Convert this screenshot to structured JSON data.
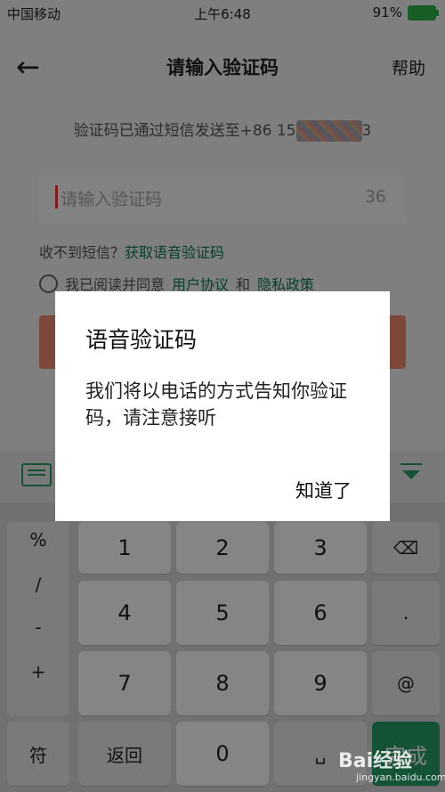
{
  "status_bar": {
    "carrier": "中国移动",
    "time": "上午6:48",
    "battery": "91%"
  },
  "header": {
    "back_icon": "←",
    "title": "请输入验证码",
    "help": "帮助"
  },
  "form": {
    "sent_prefix": "验证码已通过短信发送至+86 15",
    "sent_suffix": "3",
    "code_placeholder": "请输入验证码",
    "countdown": "36",
    "no_sms": "收不到短信？",
    "voice_link": "获取语音验证码",
    "agree_prefix": "我已阅读并同意",
    "user_agreement": "用户协议",
    "and": "和",
    "privacy_policy": "隐私政策"
  },
  "keyboard": {
    "symbols": [
      "%",
      "/",
      "-",
      "+"
    ],
    "digits": [
      "1",
      "2",
      "3",
      "4",
      "5",
      "6",
      "7",
      "8",
      "9"
    ],
    "right_keys": [
      "⌫",
      ".",
      "@"
    ],
    "bottom": {
      "fu": "符",
      "back": "返回",
      "zero": "0",
      "space": "␣",
      "done": "完成"
    }
  },
  "dialog": {
    "title": "语音验证码",
    "body": "我们将以电话的方式告知你验证码，请注意接听",
    "ok": "知道了"
  },
  "watermark": {
    "brand": "Bai经验",
    "site": "jingyan.baidu.com"
  },
  "colors": {
    "accent_green": "#2aa06a",
    "button_salmon": "#f08a6e"
  }
}
